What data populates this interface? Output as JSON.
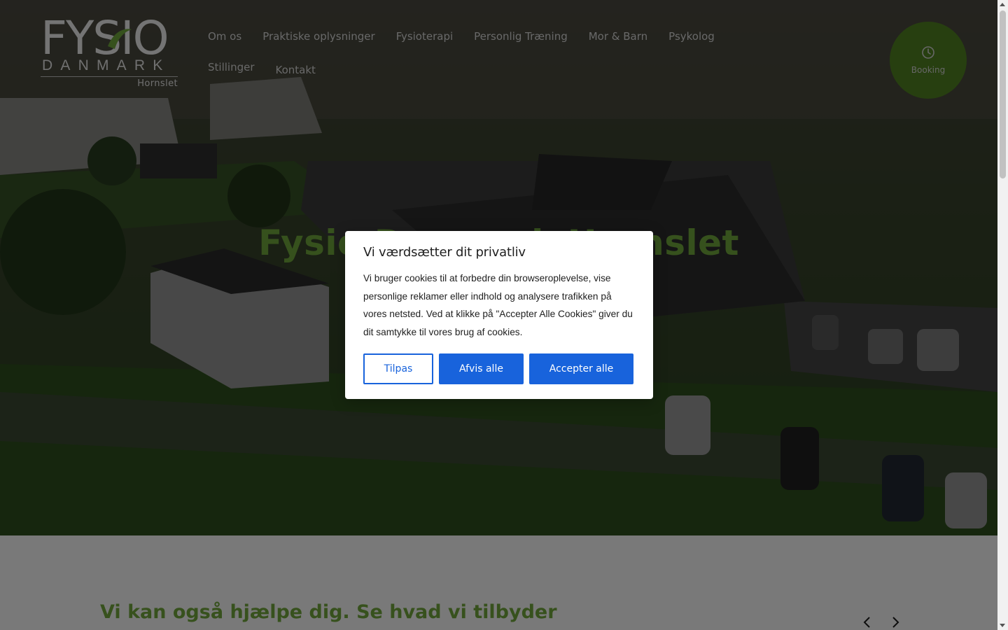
{
  "header": {
    "logo": {
      "word_top": "FYSIO",
      "word_bottom": "DANMARK",
      "location": "Hornslet"
    },
    "nav": [
      {
        "label": "Om os"
      },
      {
        "label": "Praktiske oplysninger"
      },
      {
        "label": "Fysioterapi"
      },
      {
        "label": "Personlig Træning"
      },
      {
        "label": "Mor & Barn"
      },
      {
        "label": "Psykolog"
      },
      {
        "label": "Stillinger"
      },
      {
        "label": "Kontakt"
      }
    ],
    "booking": {
      "label": "Booking",
      "icon": "clock-icon",
      "color": "#4f7f21"
    }
  },
  "hero": {
    "title": "Fysio Danmark Hornslet",
    "title_color": "#6da23a"
  },
  "services": {
    "heading": "Vi kan også hjælpe dig. Se hvad vi tilbyder",
    "prev_icon": "chevron-left-icon",
    "next_icon": "chevron-right-icon"
  },
  "cookie_banner": {
    "title": "Vi værdsætter dit privatliv",
    "text": "Vi bruger cookies til at forbedre din browseroplevelse, vise personlige reklamer eller indhold og analysere trafikken på vores netsted. Ved at klikke på \"Accepter Alle Cookies\" giver du dit samtykke til vores brug af cookies.",
    "customize_label": "Tilpas",
    "reject_label": "Afvis alle",
    "accept_label": "Accepter alle",
    "accent_color": "#1863dc"
  }
}
